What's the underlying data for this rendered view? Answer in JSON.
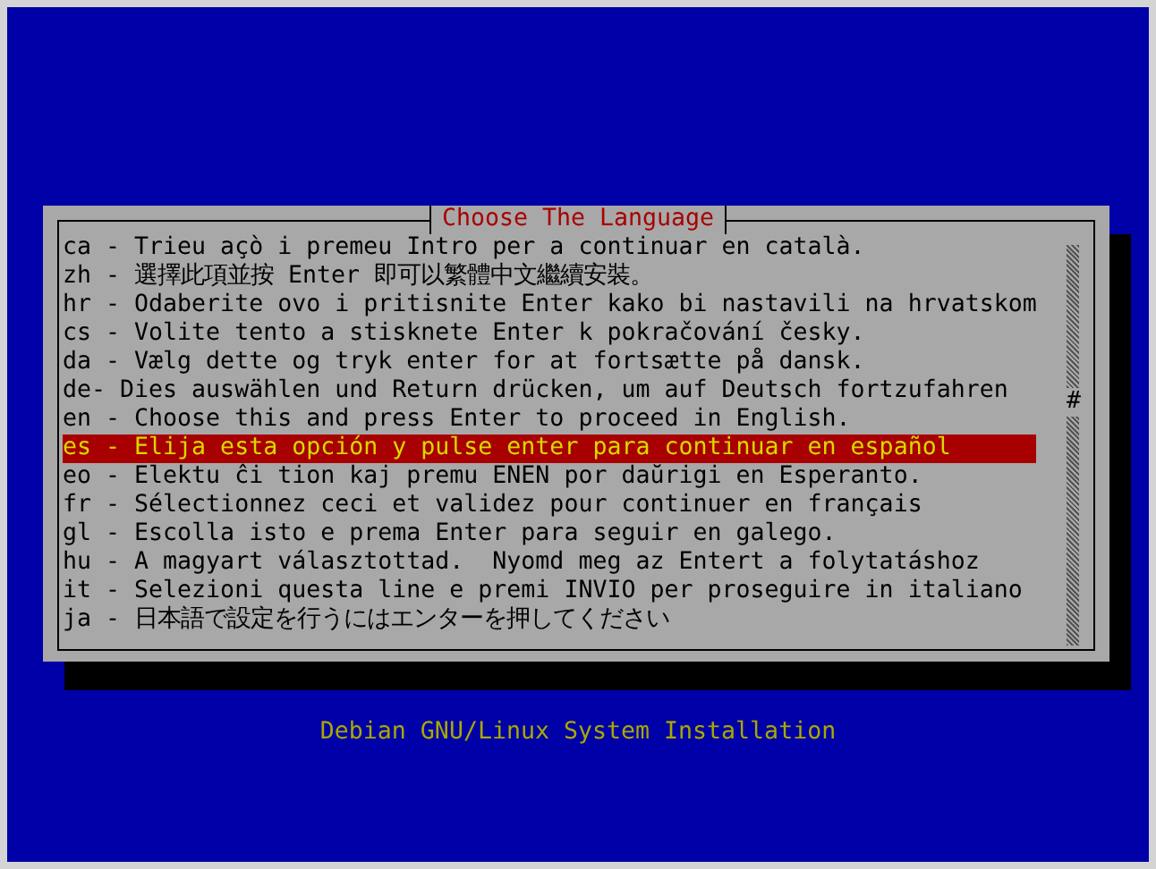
{
  "dialog": {
    "title": "Choose The Language",
    "items": [
      {
        "label": "ca - Trieu açò i premeu Intro per a continuar en català.",
        "selected": false
      },
      {
        "label": "zh - 選擇此項並按 Enter 即可以繁體中文繼續安裝。",
        "selected": false
      },
      {
        "label": "hr - Odaberite ovo i pritisnite Enter kako bi nastavili na hrvatskom",
        "selected": false
      },
      {
        "label": "cs - Volite tento a stisknete Enter k pokračování česky.",
        "selected": false
      },
      {
        "label": "da - Vælg dette og tryk enter for at fortsætte på dansk.",
        "selected": false
      },
      {
        "label": "de- Dies auswählen und Return drücken, um auf Deutsch fortzufahren",
        "selected": false
      },
      {
        "label": "en - Choose this and press Enter to proceed in English.",
        "selected": false
      },
      {
        "label": "es - Elija esta opción y pulse enter para continuar en español",
        "selected": true
      },
      {
        "label": "eo - Elektu ĉi tion kaj premu ENEN por daŭrigi en Esperanto.",
        "selected": false
      },
      {
        "label": "fr - Sélectionnez ceci et validez pour continuer en français",
        "selected": false
      },
      {
        "label": "gl - Escolla isto e prema Enter para seguir en galego.",
        "selected": false
      },
      {
        "label": "hu - A magyart választottad.  Nyomd meg az Entert a folytatáshoz",
        "selected": false
      },
      {
        "label": "it - Selezioni questa line e premi INVIO per proseguire in italiano",
        "selected": false
      },
      {
        "label": "ja - 日本語で設定を行うにはエンターを押してください",
        "selected": false
      }
    ],
    "scroll_thumb": "#"
  },
  "footer": "Debian GNU/Linux System Installation"
}
